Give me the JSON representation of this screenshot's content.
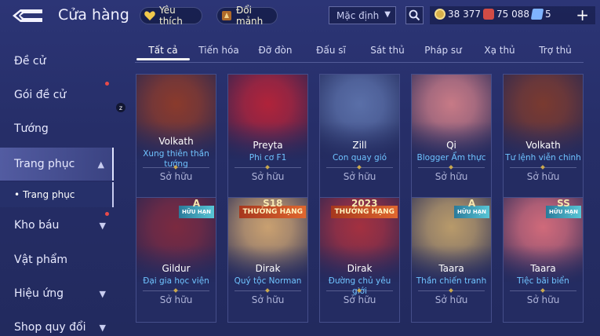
{
  "header": {
    "title": "Cửa hàng",
    "favorite_label": "Yêu thích",
    "exchange_label": "Đổi mảnh",
    "sort_value": "Mặc định",
    "currencies": [
      {
        "name": "gold",
        "value": "38 377",
        "color": "#d8b04a"
      },
      {
        "name": "vouchers",
        "value": "75 088",
        "color": "#d24b45"
      },
      {
        "name": "tickets",
        "value": "5",
        "color": "#7fb3ff"
      }
    ]
  },
  "sidebar": {
    "items": [
      {
        "label": "Đề cử"
      },
      {
        "label": "Gói đề cử"
      },
      {
        "label": "Tướng"
      },
      {
        "label": "Trang phục"
      },
      {
        "label": "Trang phục"
      },
      {
        "label": "Kho báu"
      },
      {
        "label": "Vật phẩm"
      },
      {
        "label": "Hiệu ứng"
      },
      {
        "label": "Shop quy đổi"
      }
    ],
    "z_badge": "z"
  },
  "tabs": [
    "Tất cả",
    "Tiến hóa",
    "Đỡ đòn",
    "Đấu sĩ",
    "Sát thủ",
    "Pháp sư",
    "Xạ thủ",
    "Trợ thủ"
  ],
  "cards": [
    {
      "hero": "Volkath",
      "skin": "Xung thiên thần tướng",
      "owned": "Sở hữu",
      "color": "#8a3a2c"
    },
    {
      "hero": "Preyta",
      "skin": "Phi cơ F1",
      "owned": "Sở hữu",
      "color": "#b0233a"
    },
    {
      "hero": "Zill",
      "skin": "Con quay gió",
      "owned": "Sở hữu",
      "color": "#5a6fa8"
    },
    {
      "hero": "Qi",
      "skin": "Blogger Ẩm thực",
      "owned": "Sở hữu",
      "color": "#c77a86"
    },
    {
      "hero": "Volkath",
      "skin": "Tư lệnh viễn chinh",
      "owned": "Sở hữu",
      "color": "#7a3a30"
    },
    {
      "hero": "Gildur",
      "skin": "Đại gia học viện",
      "owned": "Sở hữu",
      "color": "#7b2a40",
      "badge_big": "A",
      "badge_text": "HỮU HẠN",
      "badge_type": "limited"
    },
    {
      "hero": "Dirak",
      "skin": "Quý tộc Norman",
      "owned": "Sở hữu",
      "color": "#c9a070",
      "badge_big": "S18",
      "badge_text": "THƯỞNG HẠNG",
      "badge_type": "rank"
    },
    {
      "hero": "Dirak",
      "skin": "Đường chủ yêu giới",
      "owned": "Sở hữu",
      "color": "#a33040",
      "badge_big": "2023",
      "badge_text": "THƯỞNG HẠNG",
      "badge_type": "rank"
    },
    {
      "hero": "Taara",
      "skin": "Thần chiến tranh",
      "owned": "Sở hữu",
      "color": "#b89a6a",
      "badge_big": "A",
      "badge_text": "HỮU HẠN",
      "badge_type": "limited"
    },
    {
      "hero": "Taara",
      "skin": "Tiệc bãi biển",
      "owned": "Sở hữu",
      "color": "#d06a7a",
      "badge_big": "SS",
      "badge_text": "HỮU HẠN",
      "badge_type": "limited"
    }
  ]
}
